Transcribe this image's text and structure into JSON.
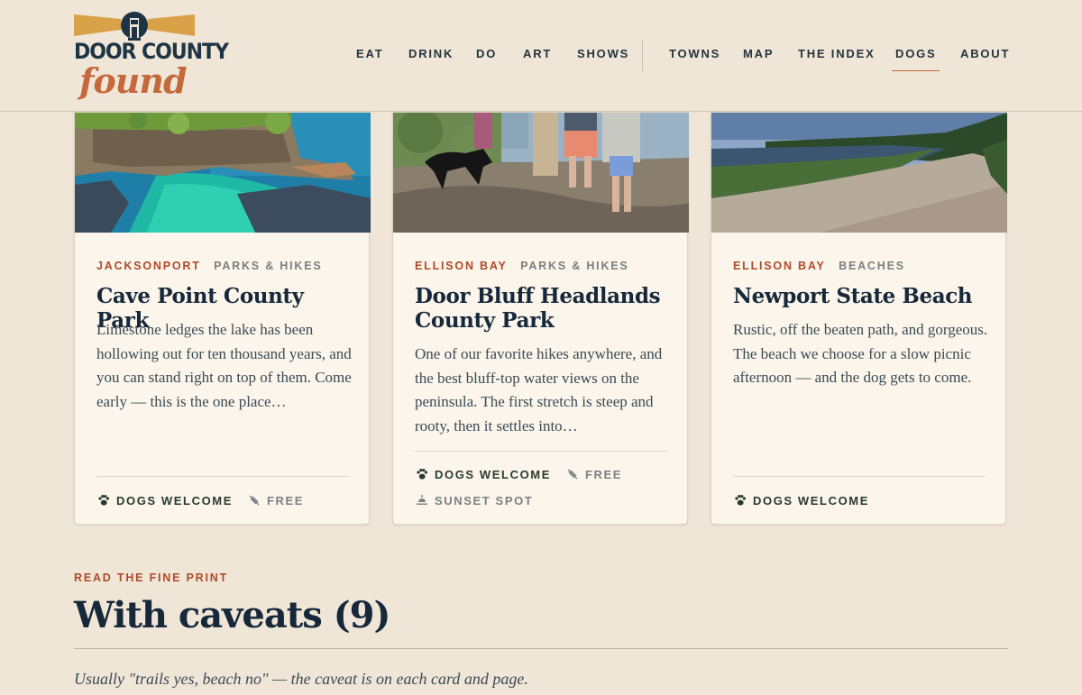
{
  "header": {
    "logo": {
      "line1": "DOOR COUNTY",
      "line2": "found"
    },
    "nav": [
      {
        "label": "EAT"
      },
      {
        "label": "DRINK"
      },
      {
        "label": "DO"
      },
      {
        "label": "ART"
      },
      {
        "label": "SHOWS"
      },
      {
        "label": "TOWNS"
      },
      {
        "label": "MAP"
      },
      {
        "label": "THE INDEX"
      },
      {
        "label": "DOGS",
        "active": true
      },
      {
        "label": "ABOUT"
      }
    ]
  },
  "cards": [
    {
      "town": "JACKSONPORT",
      "category": "PARKS & HIKES",
      "title": "Cave Point County Park",
      "description": "Limestone ledges the lake has been hollowing out for ten thousand years, and you can stand right on top of them. Come early — this is the one place…",
      "features": [
        "DOGS WELCOME",
        "FREE"
      ]
    },
    {
      "town": "ELLISON BAY",
      "category": "PARKS & HIKES",
      "title": "Door Bluff Headlands County Park",
      "description": "One of our favorite hikes anywhere, and the best bluff-top water views on the peninsula. The first stretch is steep and rooty, then it settles into…",
      "features": [
        "DOGS WELCOME",
        "FREE",
        "SUNSET SPOT"
      ]
    },
    {
      "town": "ELLISON BAY",
      "category": "BEACHES",
      "title": "Newport State Beach",
      "description": "Rustic, off the beaten path, and gorgeous. The beach we choose for a slow picnic afternoon — and the dog gets to come.",
      "features": [
        "DOGS WELCOME"
      ]
    }
  ],
  "section": {
    "eyebrow": "READ THE FINE PRINT",
    "title": "With caveats (9)",
    "note": "Usually \"trails yes, beach no\" — the caveat is on each card and page."
  },
  "colors": {
    "background": "#efe6d8",
    "card": "#fbf5ec",
    "accent": "#b04a28",
    "logo_orange": "#c5683c",
    "navy": "#16283a"
  },
  "icons": {
    "dogs_welcome": "paw-icon",
    "free": "no-fee-icon",
    "sunset_spot": "sunset-icon"
  }
}
